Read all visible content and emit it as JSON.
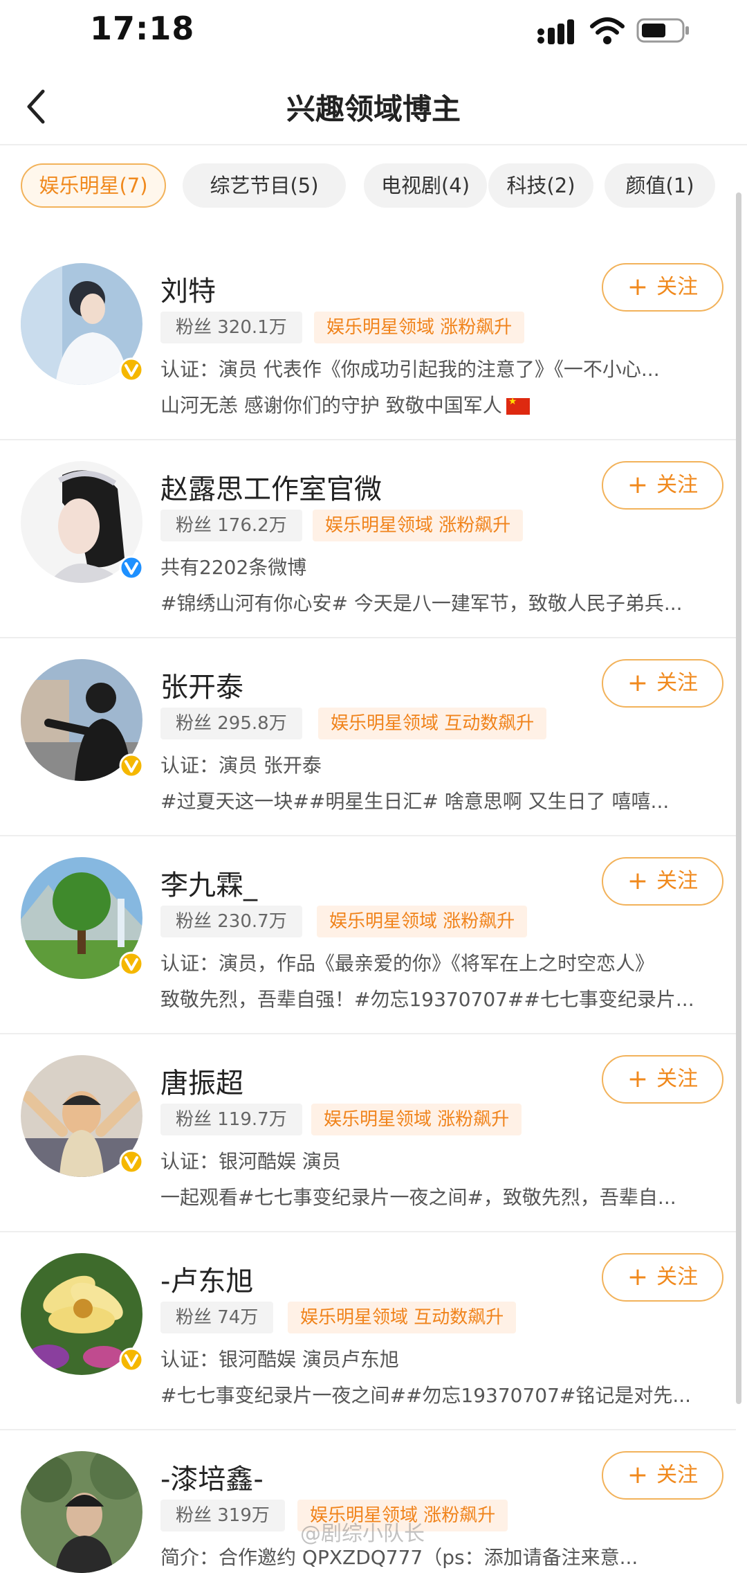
{
  "status_bar": {
    "time": "17:18"
  },
  "header": {
    "title": "兴趣领域博主"
  },
  "tabs": [
    {
      "label": "娱乐明星(7)",
      "active": true
    },
    {
      "label": "综艺节目(5)",
      "active": false
    },
    {
      "label": "电视剧(4)",
      "active": false
    },
    {
      "label": "科技(2)",
      "active": false
    },
    {
      "label": "颜值(1)",
      "active": false
    }
  ],
  "follow_label": "关注",
  "colors": {
    "accent": "#f0891d",
    "verified_gold": "#f5b700",
    "verified_blue": "#1e90ff"
  },
  "bloggers": [
    {
      "name": "刘特",
      "fans": "粉丝 320.1万",
      "tag": "娱乐明星领域 涨粉飙升",
      "line1": "认证：演员 代表作《你成功引起我的注意了》《一不小心...",
      "line2": "山河无恙 感谢你们的守护 致敬中国军人",
      "badge": "gold"
    },
    {
      "name": "赵露思工作室官微",
      "fans": "粉丝 176.2万",
      "tag": "娱乐明星领域 涨粉飙升",
      "line1": "共有2202条微博",
      "line2": "#锦绣山河有你心安# 今天是八一建军节，致敬人民子弟兵...",
      "badge": "blue"
    },
    {
      "name": "张开泰",
      "fans": "粉丝 295.8万",
      "tag": "娱乐明星领域 互动数飙升",
      "line1": "认证：演员 张开泰",
      "line2": "#过夏天这一块##明星生日汇# 啥意思啊 又生日了 嘻嘻...",
      "badge": "gold"
    },
    {
      "name": "李九霖_",
      "fans": "粉丝 230.7万",
      "tag": "娱乐明星领域 涨粉飙升",
      "line1": "认证：演员，作品《最亲爱的你》《将军在上之时空恋人》",
      "line2": "致敬先烈，吾辈自强！#勿忘19370707##七七事变纪录片...",
      "badge": "gold"
    },
    {
      "name": "唐振超",
      "fans": "粉丝 119.7万",
      "tag": "娱乐明星领域 涨粉飙升",
      "line1": "认证：银河酷娱 演员",
      "line2": "一起观看#七七事变纪录片一夜之间#，致敬先烈，吾辈自...",
      "badge": "gold"
    },
    {
      "name": "-卢东旭",
      "fans": "粉丝 74万",
      "tag": "娱乐明星领域 互动数飙升",
      "line1": "认证：银河酷娱 演员卢东旭",
      "line2": "#七七事变纪录片一夜之间##勿忘19370707#铭记是对先...",
      "badge": "gold"
    },
    {
      "name": "-漆培鑫-",
      "fans": "粉丝 319万",
      "tag": "娱乐明星领域 涨粉飙升",
      "line1": "简介：合作邀约 QPXZDQ777（ps：添加请备注来意...",
      "line2": "",
      "badge": "gold"
    }
  ],
  "watermark": "@剧综小队长"
}
